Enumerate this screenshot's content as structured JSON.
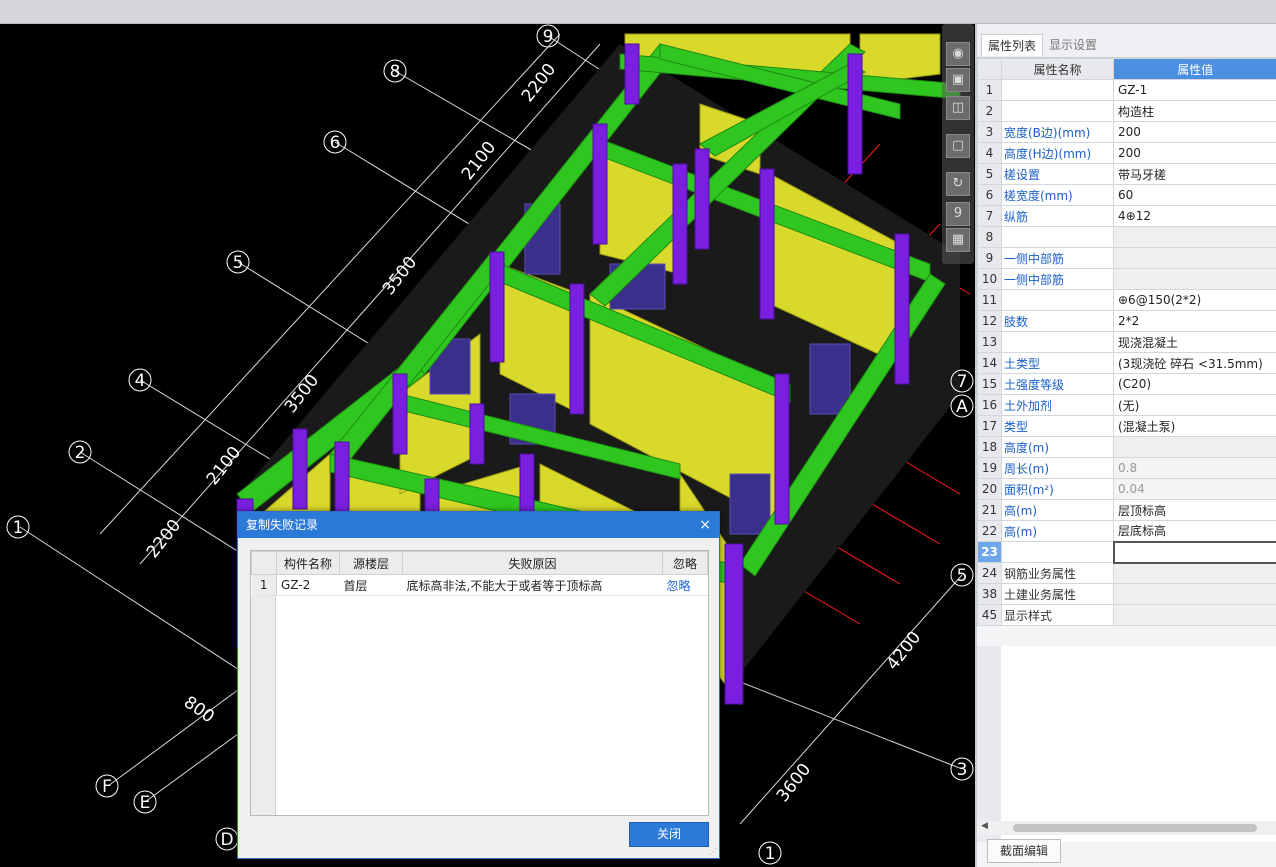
{
  "viewport": {
    "axis_bubbles": [
      "9",
      "8",
      "6",
      "5",
      "4",
      "2",
      "1",
      "F",
      "E",
      "D",
      "7",
      "A",
      "5",
      "3",
      "1"
    ],
    "dimensions": [
      "2200",
      "2100",
      "3500",
      "3500",
      "2100",
      "2200",
      "800",
      "4200",
      "3600"
    ]
  },
  "toolbar": {
    "zoom_badge": "9"
  },
  "panel": {
    "tabs": [
      "属性列表",
      "显示设置"
    ],
    "header": {
      "name": "属性名称",
      "value": "属性值"
    },
    "rows": [
      {
        "idx": "1",
        "name": "",
        "value": "GZ-1"
      },
      {
        "idx": "2",
        "name": "",
        "value": "构造柱"
      },
      {
        "idx": "3",
        "name": "宽度(B边)(mm)",
        "value": "200"
      },
      {
        "idx": "4",
        "name": "高度(H边)(mm)",
        "value": "200"
      },
      {
        "idx": "5",
        "name": "槎设置",
        "value": "带马牙槎"
      },
      {
        "idx": "6",
        "name": "槎宽度(mm)",
        "value": "60"
      },
      {
        "idx": "7",
        "name": "纵筋",
        "value": "4⊕12"
      },
      {
        "idx": "8",
        "name": "",
        "value": ""
      },
      {
        "idx": "9",
        "name": "一侧中部筋",
        "value": ""
      },
      {
        "idx": "10",
        "name": "一侧中部筋",
        "value": ""
      },
      {
        "idx": "11",
        "name": "",
        "value": "⊕6@150(2*2)"
      },
      {
        "idx": "12",
        "name": "肢数",
        "value": "2*2"
      },
      {
        "idx": "13",
        "name": "",
        "value": "现浇混凝土"
      },
      {
        "idx": "14",
        "name": "土类型",
        "value": "(3现浇砼 碎石 <31.5mm)"
      },
      {
        "idx": "15",
        "name": "土强度等级",
        "value": "(C20)"
      },
      {
        "idx": "16",
        "name": "土外加剂",
        "value": "(无)"
      },
      {
        "idx": "17",
        "name": "类型",
        "value": "(混凝土泵)"
      },
      {
        "idx": "18",
        "name": "高度(m)",
        "value": ""
      },
      {
        "idx": "19",
        "name": "周长(m)",
        "value": "0.8"
      },
      {
        "idx": "20",
        "name": "面积(m²)",
        "value": "0.04"
      },
      {
        "idx": "21",
        "name": "高(m)",
        "value": "层顶标高"
      },
      {
        "idx": "22",
        "name": "高(m)",
        "value": "层底标高"
      },
      {
        "idx": "23",
        "name": "",
        "value": ""
      },
      {
        "idx": "24",
        "name": "钢筋业务属性",
        "value": ""
      },
      {
        "idx": "38",
        "name": "土建业务属性",
        "value": ""
      },
      {
        "idx": "45",
        "name": "显示样式",
        "value": ""
      }
    ],
    "section_button": "截面编辑"
  },
  "dialog": {
    "title": "复制失败记录",
    "close_glyph": "×",
    "columns": [
      "构件名称",
      "源楼层",
      "失败原因",
      "忽略"
    ],
    "rows": [
      {
        "num": "1",
        "component": "GZ-2",
        "floor": "首层",
        "reason": "底标高非法,不能大于或者等于顶标高",
        "action": "忽略"
      }
    ],
    "close_button": "关闭"
  },
  "colors": {
    "beam": "#2fc71f",
    "wall": "#d9d92b",
    "column": "#7a1fe0",
    "grid": "#ff1a1a",
    "dialog_title": "#2b7ad8",
    "annotation_arrow": "#ff2a1a"
  }
}
